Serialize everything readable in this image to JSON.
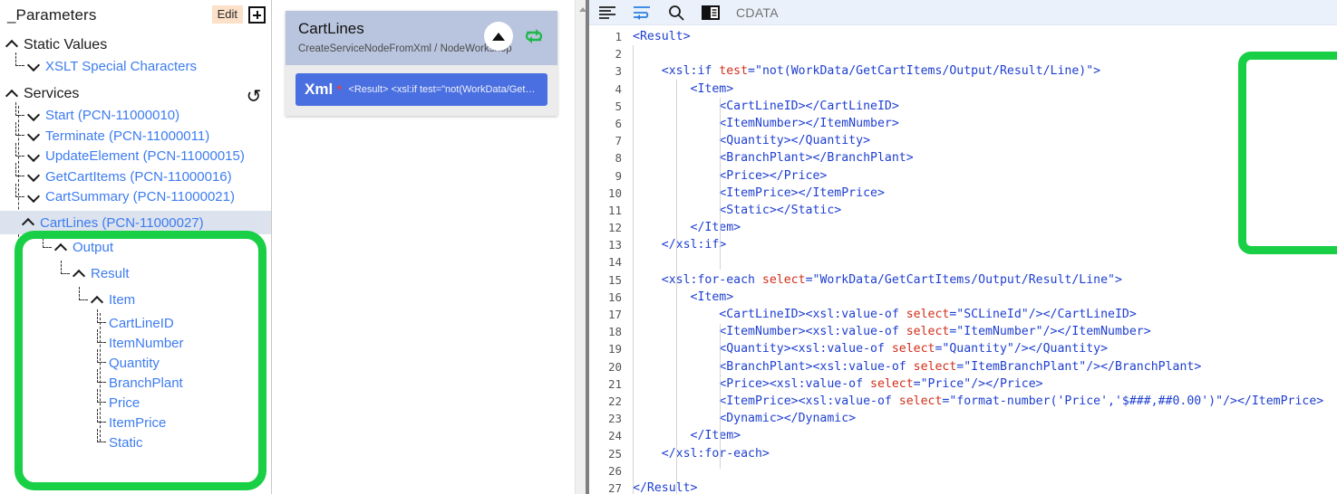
{
  "left_panel": {
    "title": "_Parameters",
    "edit_label": "Edit",
    "add_icon": "plus-icon",
    "refresh_icon": "refresh-icon",
    "groups": [
      {
        "label": "Static Values",
        "expanded": true
      },
      {
        "label": "Services",
        "expanded": true
      }
    ],
    "static_values": [
      {
        "label": "XSLT Special Characters"
      }
    ],
    "services": [
      {
        "label": "Start (PCN-11000010)"
      },
      {
        "label": "Terminate (PCN-11000011)"
      },
      {
        "label": "UpdateElement (PCN-11000015)"
      },
      {
        "label": "GetCartItems (PCN-11000016)"
      },
      {
        "label": "CartSummary (PCN-11000021)"
      },
      {
        "label": "CartLines (PCN-11000027)"
      }
    ],
    "selected_service": "CartLines (PCN-11000027)",
    "tree_nodes": [
      {
        "label": "Output",
        "depth": 1
      },
      {
        "label": "Result",
        "depth": 2
      },
      {
        "label": "Item",
        "depth": 3
      }
    ],
    "leaf_fields": [
      "CartLineID",
      "ItemNumber",
      "Quantity",
      "BranchPlant",
      "Price",
      "ItemPrice",
      "Static"
    ]
  },
  "mid_panel": {
    "card": {
      "title": "CartLines",
      "subtitle": "CreateServiceNodeFromXml / NodeWorkshop",
      "collapse_icon": "triangle-up-icon",
      "refresh_icon": "refresh-circular-icon",
      "chip": {
        "label": "Xml",
        "required_marker": "*",
        "snippet": "<Result>  <xsl:if test=\"not(WorkData/GetCart..."
      }
    }
  },
  "editor": {
    "toolbar": {
      "format_icon": "align-left-icon",
      "wrap_icon": "word-wrap-icon",
      "search_icon": "search-icon",
      "panel_icon": "toggle-panel-icon",
      "mode_label": "CDATA"
    },
    "lines": [
      {
        "n": 1,
        "text": "<Result>"
      },
      {
        "n": 2,
        "text": ""
      },
      {
        "n": 3,
        "text": "    <xsl:if test=\"not(WorkData/GetCartItems/Output/Result/Line)\">"
      },
      {
        "n": 4,
        "text": "        <Item>"
      },
      {
        "n": 5,
        "text": "            <CartLineID></CartLineID>"
      },
      {
        "n": 6,
        "text": "            <ItemNumber></ItemNumber>"
      },
      {
        "n": 7,
        "text": "            <Quantity></Quantity>"
      },
      {
        "n": 8,
        "text": "            <BranchPlant></BranchPlant>"
      },
      {
        "n": 9,
        "text": "            <Price></Price>"
      },
      {
        "n": 10,
        "text": "            <ItemPrice></ItemPrice>"
      },
      {
        "n": 11,
        "text": "            <Static></Static>"
      },
      {
        "n": 12,
        "text": "        </Item>"
      },
      {
        "n": 13,
        "text": "    </xsl:if>"
      },
      {
        "n": 14,
        "text": ""
      },
      {
        "n": 15,
        "text": "    <xsl:for-each select=\"WorkData/GetCartItems/Output/Result/Line\">"
      },
      {
        "n": 16,
        "text": "        <Item>"
      },
      {
        "n": 17,
        "text": "            <CartLineID><xsl:value-of select=\"SCLineId\"/></CartLineID>"
      },
      {
        "n": 18,
        "text": "            <ItemNumber><xsl:value-of select=\"ItemNumber\"/></ItemNumber>"
      },
      {
        "n": 19,
        "text": "            <Quantity><xsl:value-of select=\"Quantity\"/></Quantity>"
      },
      {
        "n": 20,
        "text": "            <BranchPlant><xsl:value-of select=\"ItemBranchPlant\"/></BranchPlant>"
      },
      {
        "n": 21,
        "text": "            <Price><xsl:value-of select=\"Price\"/></Price>"
      },
      {
        "n": 22,
        "text": "            <ItemPrice><xsl:value-of select=\"format-number('Price','$###,##0.00')\"/></ItemPrice>"
      },
      {
        "n": 23,
        "text": "            <Dynamic></Dynamic>"
      },
      {
        "n": 24,
        "text": "        </Item>"
      },
      {
        "n": 25,
        "text": "    </xsl:for-each>"
      },
      {
        "n": 26,
        "text": ""
      },
      {
        "n": 27,
        "text": "</Result>"
      }
    ]
  },
  "annotations": {
    "highlight_color": "#18cf45",
    "left_highlight_target": "CartLines (PCN-11000027) output tree",
    "code_highlight_target": "xsl:if block lines 3-13"
  }
}
